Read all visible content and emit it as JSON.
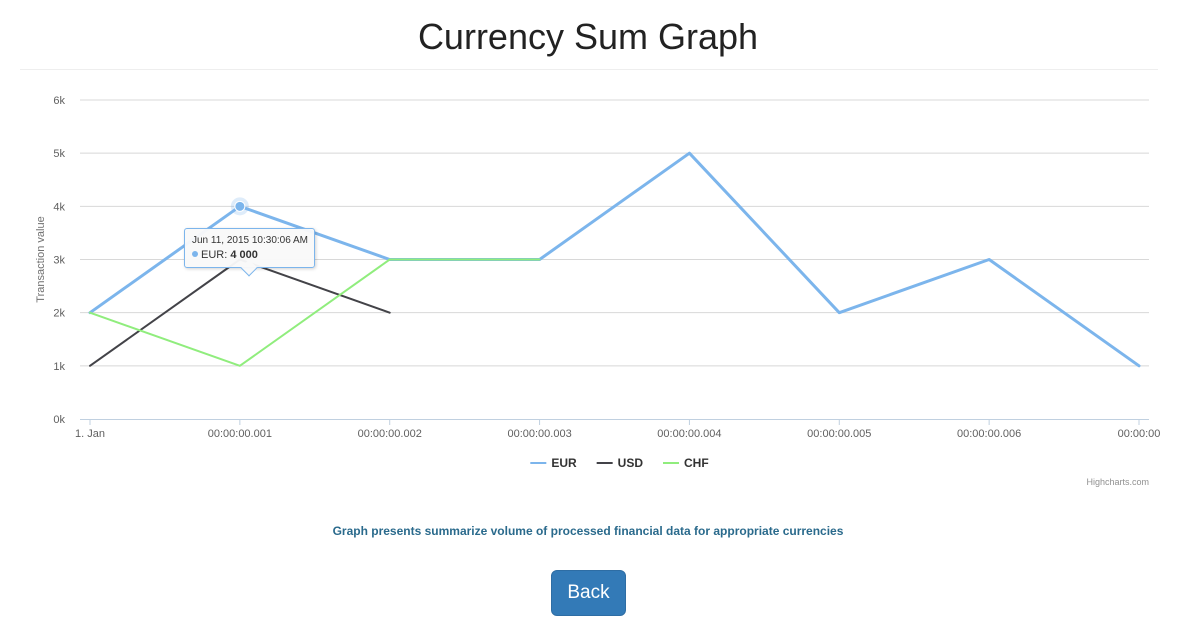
{
  "page": {
    "title": "Currency Sum Graph",
    "caption": "Graph presents summarize volume of processed financial data for appropriate currencies",
    "back_label": "Back"
  },
  "chart_data": {
    "type": "line",
    "title": "",
    "xlabel": "",
    "ylabel": "Transaction value",
    "categories": [
      "1. Jan",
      "00:00:00.001",
      "00:00:00.002",
      "00:00:00.003",
      "00:00:00.004",
      "00:00:00.005",
      "00:00:00.006",
      "00:00:00"
    ],
    "ylim": [
      0,
      6000
    ],
    "yticks": [
      0,
      1000,
      2000,
      3000,
      4000,
      5000,
      6000
    ],
    "ytick_labels": [
      "0k",
      "1k",
      "2k",
      "3k",
      "4k",
      "5k",
      "6k"
    ],
    "grid": true,
    "legend_position": "bottom-center",
    "series": [
      {
        "name": "EUR",
        "color": "#7cb5ec",
        "values": [
          2000,
          4000,
          3000,
          3000,
          5000,
          2000,
          3000,
          1000
        ]
      },
      {
        "name": "USD",
        "color": "#434348",
        "values": [
          1000,
          3000,
          2000,
          null,
          null,
          null,
          null,
          null
        ]
      },
      {
        "name": "CHF",
        "color": "#90ed7d",
        "values": [
          2000,
          1000,
          3000,
          3000,
          null,
          null,
          null,
          null
        ]
      }
    ],
    "tooltip": {
      "series_index": 0,
      "point_index": 1,
      "header": "Jun 11, 2015 10:30:06 AM",
      "series_label": "EUR",
      "value_text": "4 000"
    },
    "credits": "Highcharts.com"
  }
}
